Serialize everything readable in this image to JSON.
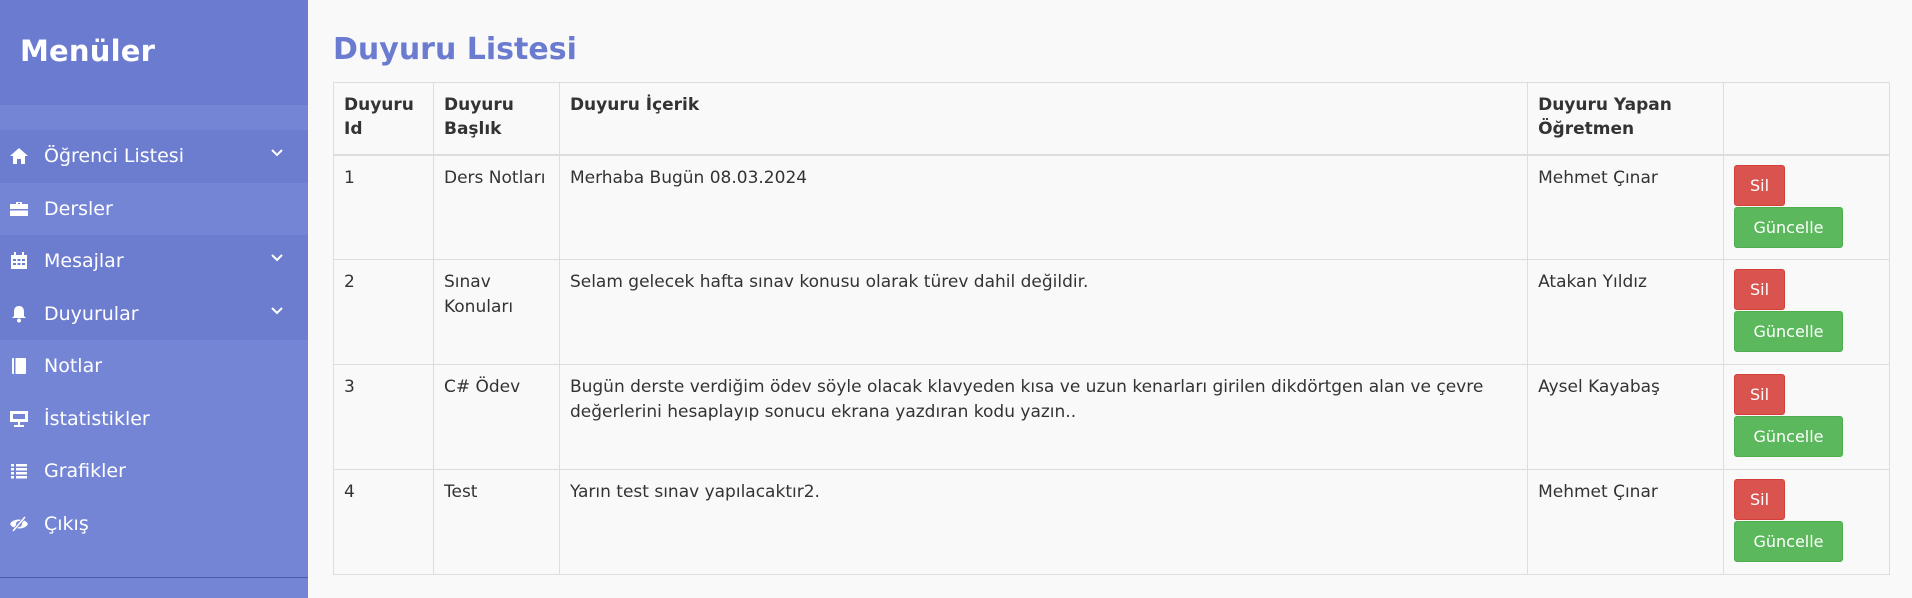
{
  "sidebar": {
    "title": "Menüler",
    "items": [
      {
        "label": "Öğrenci Listesi",
        "icon": "home-icon",
        "has_submenu": true
      },
      {
        "label": "Dersler",
        "icon": "briefcase-icon",
        "has_submenu": false
      },
      {
        "label": "Mesajlar",
        "icon": "calendar-icon",
        "has_submenu": true
      },
      {
        "label": "Duyurular",
        "icon": "bell-icon",
        "has_submenu": true
      },
      {
        "label": "Notlar",
        "icon": "book-icon",
        "has_submenu": false
      },
      {
        "label": "İstatistikler",
        "icon": "presentation-icon",
        "has_submenu": false
      },
      {
        "label": "Grafikler",
        "icon": "list-icon",
        "has_submenu": false
      },
      {
        "label": "Çıkış",
        "icon": "eye-slash-icon",
        "has_submenu": false
      }
    ]
  },
  "main": {
    "title": "Duyuru Listesi",
    "table": {
      "headers": [
        "Duyuru Id",
        "Duyuru Başlık",
        "Duyuru İçerik",
        "Duyuru Yapan Öğretmen",
        ""
      ],
      "rows": [
        {
          "id": "1",
          "title": "Ders Notları",
          "content": "Merhaba Bugün 08.03.2024",
          "teacher": "Mehmet Çınar"
        },
        {
          "id": "2",
          "title": "Sınav Konuları",
          "content": "Selam gelecek hafta sınav konusu olarak türev dahil değildir.",
          "teacher": "Atakan Yıldız"
        },
        {
          "id": "3",
          "title": "C# Ödev",
          "content": "Bugün derste verdiğim ödev söyle olacak klavyeden kısa ve uzun kenarları girilen dikdörtgen alan ve çevre değerlerini hesaplayıp sonucu ekrana yazdıran kodu yazın..",
          "teacher": "Aysel Kayabaş"
        },
        {
          "id": "4",
          "title": "Test",
          "content": "Yarın test sınav yapılacaktır2.",
          "teacher": "Mehmet Çınar"
        }
      ],
      "delete_label": "Sil",
      "update_label": "Güncelle"
    }
  },
  "colors": {
    "sidebar_bg": "#7585d6",
    "sidebar_header_bg": "#6b7bcf",
    "title_color": "#6b7bcf",
    "danger": "#d9534f",
    "success": "#5cb85c"
  }
}
